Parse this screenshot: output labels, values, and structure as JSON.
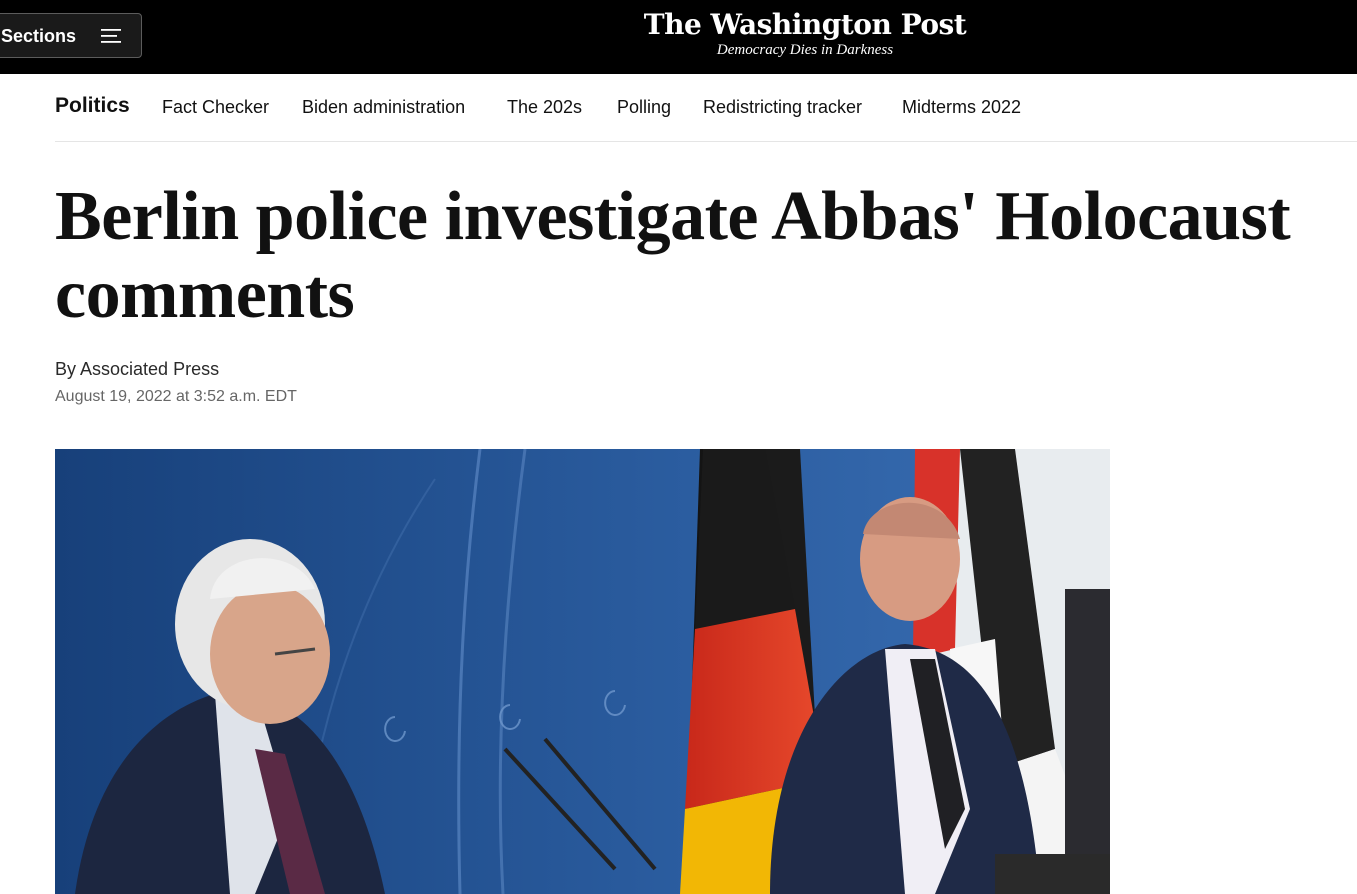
{
  "header": {
    "sections_label": "Sections",
    "logo_text": "The Washington Post",
    "tagline": "Democracy Dies in Darkness",
    "background_color": "#000000"
  },
  "subnav": {
    "items": [
      {
        "label": "Politics",
        "active": true
      },
      {
        "label": "Fact Checker",
        "active": false
      },
      {
        "label": "Biden administration",
        "active": false
      },
      {
        "label": "The 202s",
        "active": false
      },
      {
        "label": "Polling",
        "active": false
      },
      {
        "label": "Redistricting tracker",
        "active": false
      },
      {
        "label": "Midterms 2022",
        "active": false
      }
    ]
  },
  "article": {
    "headline": "Berlin police investigate Abbas' Holocaust comments",
    "byline_prefix": "By ",
    "author": "Associated Press",
    "timestamp": "August 19, 2022 at 3:52 a.m. EDT"
  },
  "photo": {
    "subject": "press-conference-photo",
    "colors": {
      "backdrop_blue": "#1f4f8a",
      "flag_black": "#111111",
      "flag_red": "#d62b1e",
      "flag_gold": "#f2b705",
      "suit_navy": "#1c2640"
    }
  }
}
